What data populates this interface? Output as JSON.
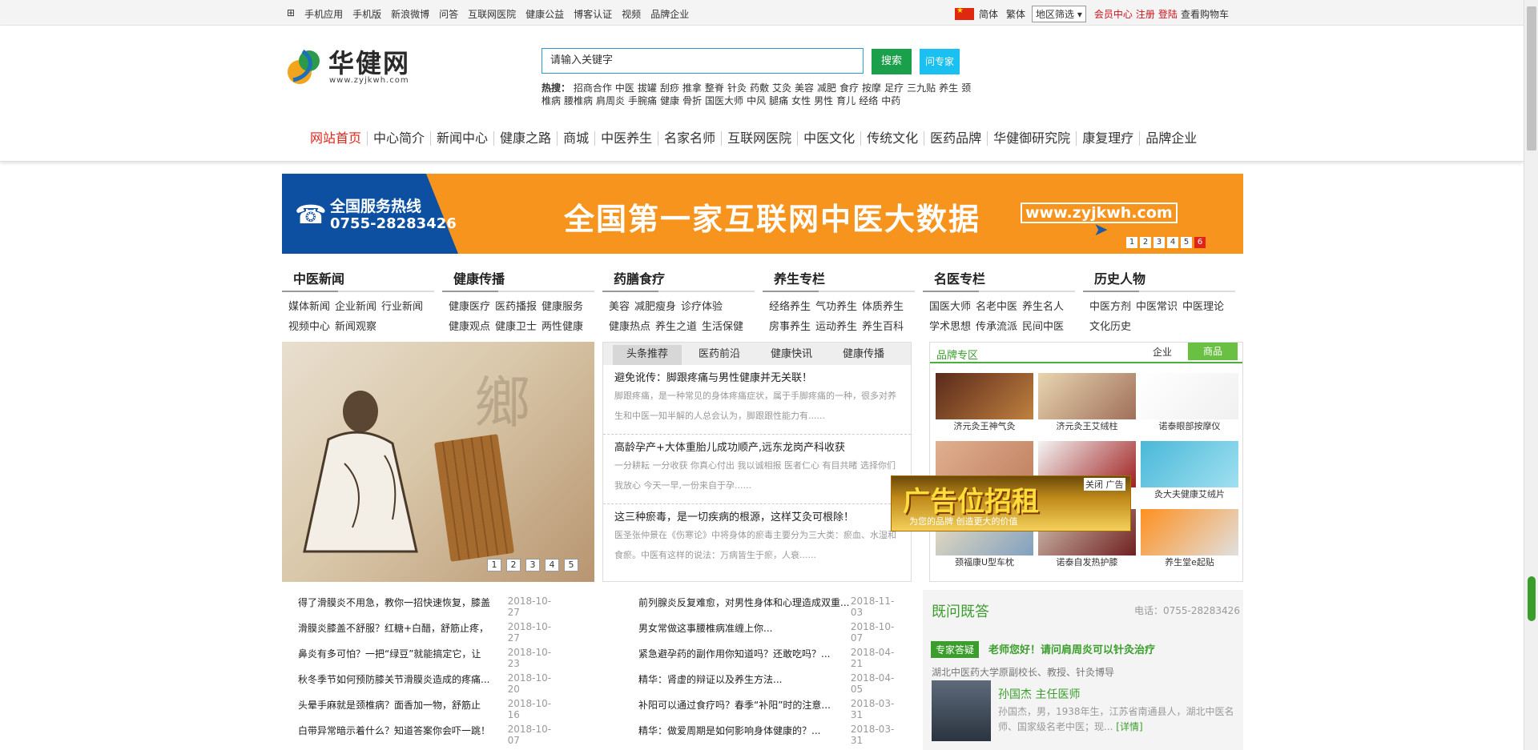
{
  "topbar": {
    "links": [
      "手机应用",
      "手机版",
      "新浪微博",
      "问答",
      "互联网医院",
      "健康公益",
      "博客认证",
      "视频",
      "品牌企业"
    ],
    "simplified": "简体",
    "traditional": "繁体",
    "region_select": "地区筛选",
    "member_center": "会员中心",
    "register": "注册",
    "login": "登陆",
    "cart": "查看购物车"
  },
  "logo": {
    "name": "华健网",
    "url": "www.zyjkwh.com"
  },
  "search": {
    "placeholder": "请输入关键字",
    "search_btn": "搜索",
    "ask_btn": "问专家"
  },
  "hot": {
    "label": "热搜：",
    "items": [
      "招商合作",
      "中医",
      "拔罐",
      "刮痧",
      "推拿",
      "整脊",
      "针灸",
      "药敷",
      "艾灸",
      "美容",
      "减肥",
      "食疗",
      "按摩",
      "足疗",
      "三九贴",
      "养生",
      "颈椎病",
      "腰椎病",
      "肩周炎",
      "手腕痛",
      "健康",
      "骨折",
      "国医大师",
      "中风",
      "腿痛",
      "女性",
      "男性",
      "育儿",
      "经络",
      "中药"
    ]
  },
  "nav": [
    "网站首页",
    "中心简介",
    "新闻中心",
    "健康之路",
    "商城",
    "中医养生",
    "名家名师",
    "互联网医院",
    "中医文化",
    "传统文化",
    "医药品牌",
    "华健御研究院",
    "康复理疗",
    "品牌企业"
  ],
  "banner": {
    "hotline_label": "全国服务热线",
    "hotline": "0755-28283426",
    "headline": "全国第一家互联网中医大数据",
    "site": "www.zyjkwh.com",
    "pages": [
      "1",
      "2",
      "3",
      "4",
      "5",
      "6"
    ]
  },
  "categories": [
    {
      "title": "中医新闻",
      "links": [
        "媒体新闻",
        "企业新闻",
        "行业新闻",
        "视频中心",
        "新闻观察"
      ]
    },
    {
      "title": "健康传播",
      "links": [
        "健康医疗",
        "医药播报",
        "健康服务",
        "健康观点",
        "健康卫士",
        "两性健康"
      ]
    },
    {
      "title": "药膳食疗",
      "links": [
        "美容",
        "减肥瘦身",
        "诊疗体验",
        "健康热点",
        "养生之道",
        "生活保健"
      ]
    },
    {
      "title": "养生专栏",
      "links": [
        "经络养生",
        "气功养生",
        "体质养生",
        "房事养生",
        "运动养生",
        "养生百科"
      ]
    },
    {
      "title": "名医专栏",
      "links": [
        "国医大师",
        "名老中医",
        "养生名人",
        "学术思想",
        "传承流派",
        "民间中医"
      ]
    },
    {
      "title": "历史人物",
      "links": [
        "中医方剂",
        "中医常识",
        "中医理论",
        "文化历史"
      ]
    }
  ],
  "slideshow": {
    "pages": [
      "1",
      "2",
      "3",
      "4",
      "5"
    ]
  },
  "news": {
    "tabs": [
      "头条推荐",
      "医药前沿",
      "健康快讯",
      "健康传播"
    ],
    "items": [
      {
        "title": "避免讹传：脚跟疼痛与男性健康并无关联！",
        "desc": "脚跟疼痛，是一种常见的身体疼痛症状，属于手脚疼痛的一种，很多对养生和中医一知半解的人总会认为，脚跟跟性能力有......"
      },
      {
        "title": "高龄孕产+大体重胎儿成功顺产,远东龙岗产科收获",
        "desc": "一分耕耘 一分收获 你真心付出 我以诚相报 医者仁心 有目共睹 选择你们 我放心 今天一早,一份来自于孕......"
      },
      {
        "title": "这三种瘀毒，是一切疾病的根源，这样艾灸可根除！",
        "desc": "医圣张仲景在《伤寒论》中将身体的瘀毒主要分为三大类：瘀血、水湿和食瘀。中医有这样的说法：万病皆生于瘀，人衰......"
      }
    ]
  },
  "brand": {
    "title": "品牌专区",
    "tab_company": "企业",
    "tab_goods": "商品",
    "products": [
      "济元灸王神气灸",
      "济元灸王艾绒柱",
      "诺泰眼部按摩仪",
      "",
      "",
      "灸大夫健康艾绒片",
      "颈福康U型车枕",
      "诺泰自发热护膝",
      "养生堂e起贴"
    ]
  },
  "ad": {
    "text": "广告位招租",
    "sub": "为您的品牌 创造更大的价值",
    "close": "关闭 广告"
  },
  "list_left": [
    {
      "title": "得了滑膜炎不用急，教你一招快速恢复，膝盖",
      "date": "2018-10-27"
    },
    {
      "title": "滑膜炎膝盖不舒服？红糖+白醋，舒筋止疼，",
      "date": "2018-10-27"
    },
    {
      "title": "鼻炎有多可怕？一把“绿豆”就能搞定它，让",
      "date": "2018-10-23"
    },
    {
      "title": "秋冬季节如何预防膝关节滑膜炎造成的疼痛...",
      "date": "2018-10-20"
    },
    {
      "title": "头晕手麻就是颈椎病？面香加一物，舒筋止",
      "date": "2018-10-16"
    },
    {
      "title": "白带异常暗示着什么？知道答案你会吓一跳！",
      "date": "2018-10-07"
    }
  ],
  "list_mid": [
    {
      "title": "前列腺炎反复难愈，对男性身体和心理造成双重...",
      "date": "2018-11-03"
    },
    {
      "title": "男女常做这事腰椎病准缠上你...",
      "date": "2018-10-07"
    },
    {
      "title": "紧急避孕药的副作用你知道吗？还敢吃吗？...",
      "date": "2018-04-21"
    },
    {
      "title": "精华：肾虚的辩证以及养生方法...",
      "date": "2018-04-05"
    },
    {
      "title": "补阳可以通过食疗吗？春季“补阳”时的注意...",
      "date": "2018-03-31"
    },
    {
      "title": "精华：做爱周期是如何影响身体健康的？...",
      "date": "2018-03-31"
    }
  ],
  "faq": {
    "title": "既问既答",
    "tel": "电话：0755-28283426",
    "tag": "专家答疑",
    "question": "老师您好！请问肩周炎可以针灸治疗",
    "subtitle": "湖北中医药大学原副校长、教授、针灸博导",
    "doctor": "孙国杰 主任医师",
    "desc": "孙国杰，男，1938年生，江苏省南通县人，湖北中医名师、国家级名老中医；现...",
    "more": "[详情]"
  }
}
